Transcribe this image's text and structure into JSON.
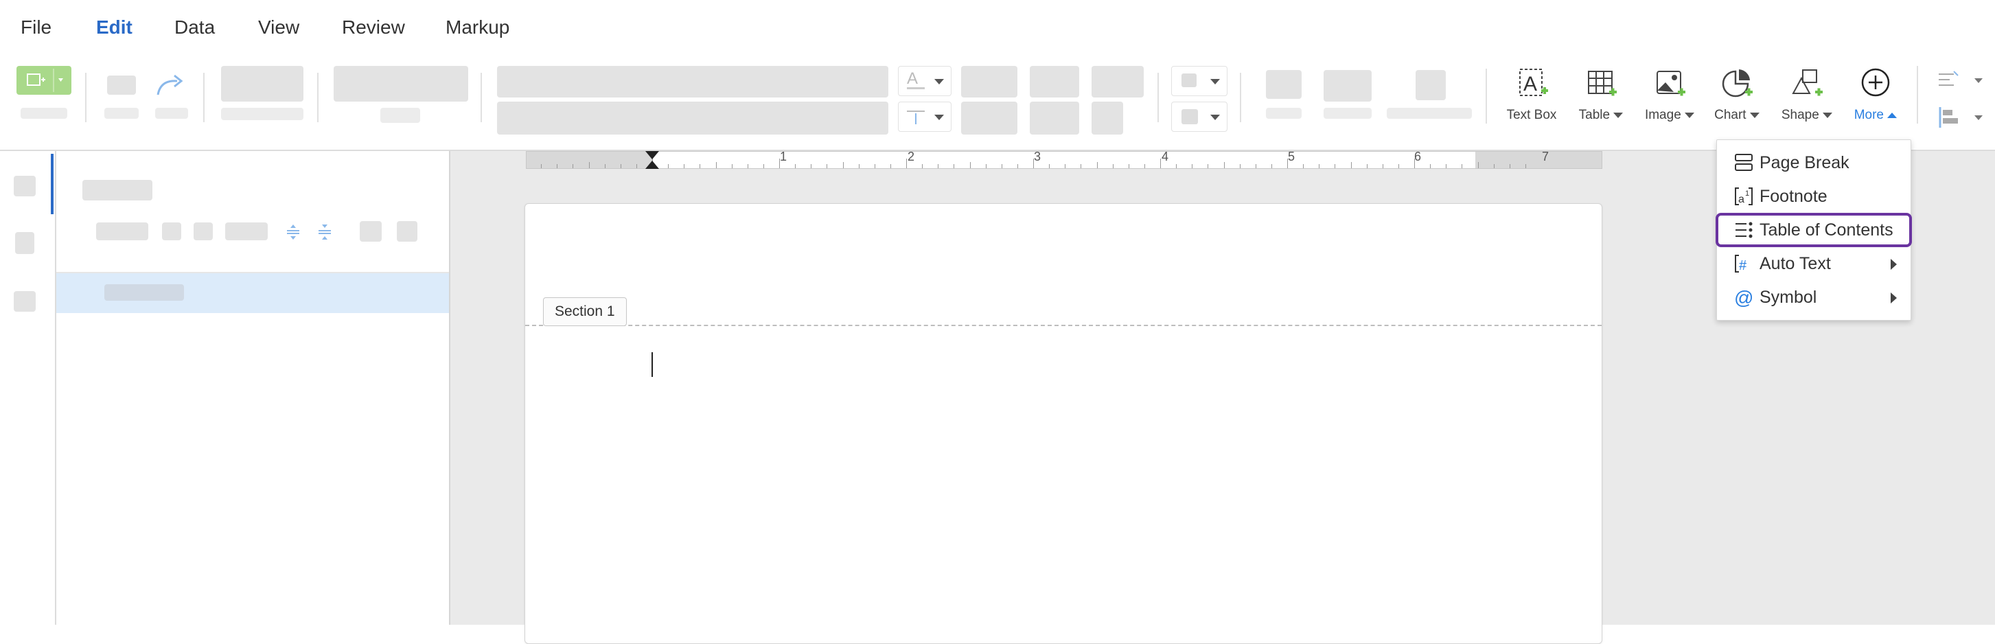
{
  "menu": [
    {
      "label": "File"
    },
    {
      "label": "Edit",
      "active": true
    },
    {
      "label": "Data"
    },
    {
      "label": "View"
    },
    {
      "label": "Review"
    },
    {
      "label": "Markup"
    }
  ],
  "toolbar": {
    "insert_tools": [
      {
        "label": "Text Box",
        "icon": "text-box-icon"
      },
      {
        "label": "Table",
        "icon": "table-icon"
      },
      {
        "label": "Image",
        "icon": "image-icon"
      },
      {
        "label": "Chart",
        "icon": "chart-icon"
      },
      {
        "label": "Shape",
        "icon": "shape-icon"
      },
      {
        "label": "More",
        "icon": "plus-circle-icon"
      }
    ]
  },
  "document": {
    "section_label": "Section 1",
    "ruler_numbers": [
      "1",
      "2",
      "3",
      "4",
      "5",
      "6",
      "7"
    ]
  },
  "more_menu": {
    "items": [
      {
        "label": "Page Break",
        "icon": "page-break-icon",
        "submenu": false
      },
      {
        "label": "Footnote",
        "icon": "footnote-icon",
        "submenu": false
      },
      {
        "label": "Table of Contents",
        "icon": "table-of-contents-icon",
        "submenu": false,
        "highlighted": true
      },
      {
        "label": "Auto Text",
        "icon": "auto-text-icon",
        "submenu": true
      },
      {
        "label": "Symbol",
        "icon": "at-symbol-icon",
        "submenu": true
      }
    ]
  },
  "colors": {
    "accent": "#2a6ac7",
    "highlight": "#6a34a0",
    "insert_green": "#7bc043",
    "selection": "#dcebfa"
  }
}
